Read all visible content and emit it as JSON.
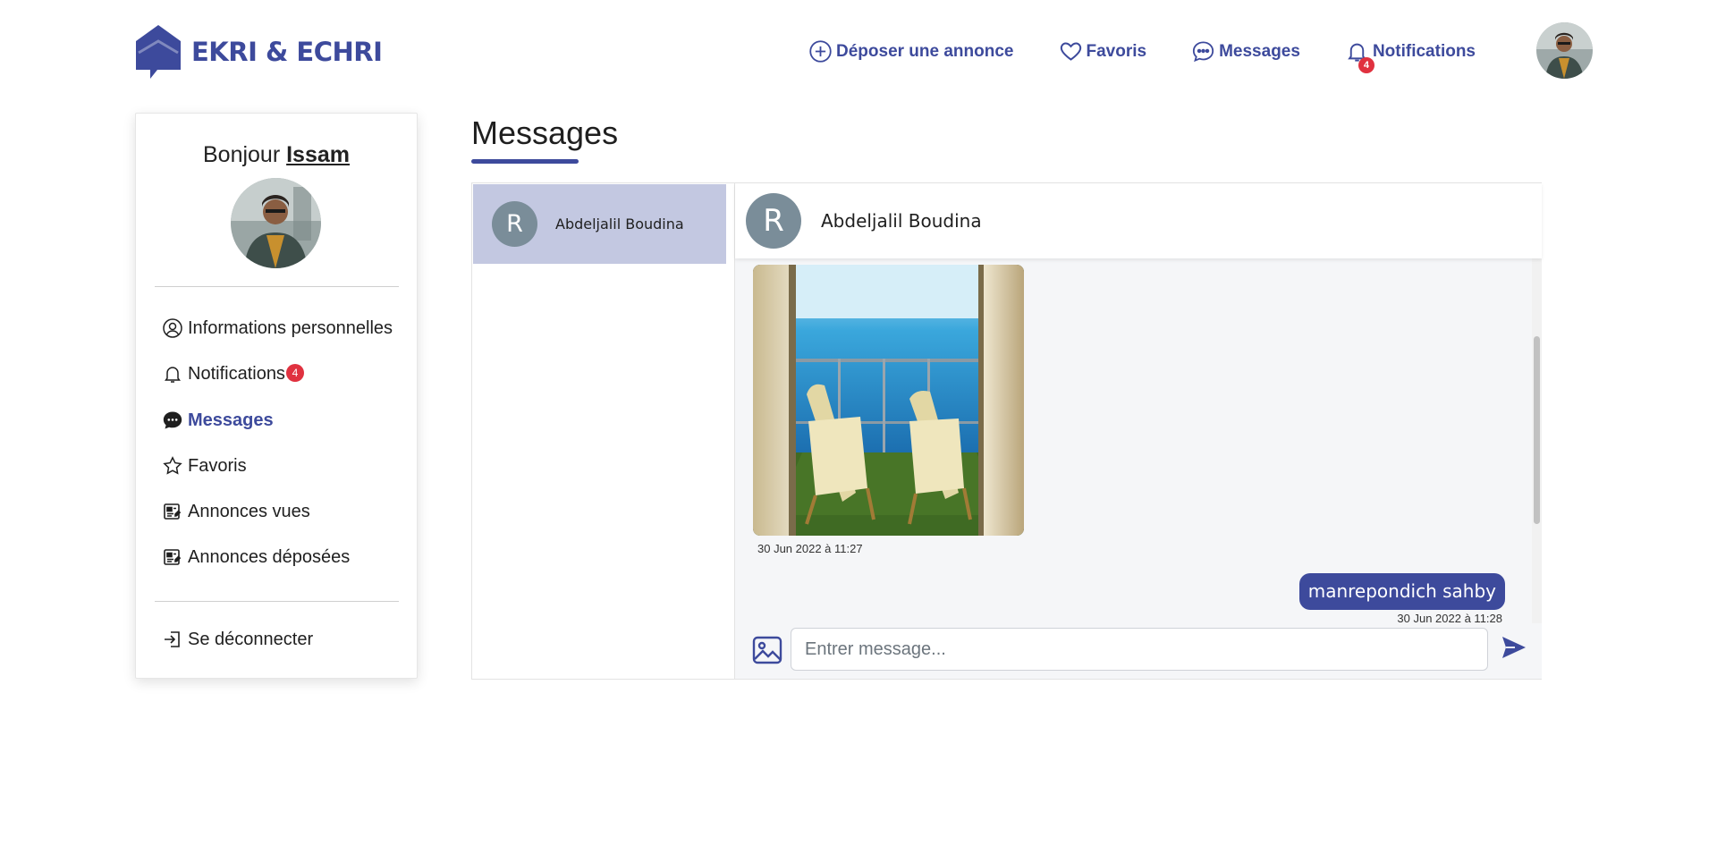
{
  "brand": {
    "name": "EKRI & ECHRI",
    "color": "#3d4a9c"
  },
  "nav": {
    "post_ad": "Déposer une annonce",
    "favorites": "Favoris",
    "messages": "Messages",
    "notifications": "Notifications",
    "notification_count": "4"
  },
  "sidebar": {
    "greeting_prefix": "Bonjour",
    "user_name": "Issam",
    "items": [
      {
        "label": "Informations personnelles",
        "icon": "user-circle-icon"
      },
      {
        "label": "Notifications",
        "icon": "bell-icon",
        "badge": "4"
      },
      {
        "label": "Messages",
        "icon": "chat-icon",
        "active": true
      },
      {
        "label": "Favoris",
        "icon": "star-icon"
      },
      {
        "label": "Annonces vues",
        "icon": "listing-icon"
      },
      {
        "label": "Annonces déposées",
        "icon": "listing-icon"
      }
    ],
    "logout": "Se déconnecter"
  },
  "page": {
    "title": "Messages"
  },
  "conversations": [
    {
      "initial": "R",
      "name": "Abdeljalil Boudina",
      "selected": true
    }
  ],
  "chat": {
    "contact_initial": "R",
    "contact_name": "Abdeljalil Boudina",
    "messages": [
      {
        "type": "image",
        "time": "30 Jun 2022 à 11:27",
        "side": "left"
      },
      {
        "type": "text",
        "text": "manrepondich sahby",
        "time": "30 Jun 2022 à 11:28",
        "side": "right"
      }
    ],
    "input_placeholder": "Entrer message..."
  }
}
